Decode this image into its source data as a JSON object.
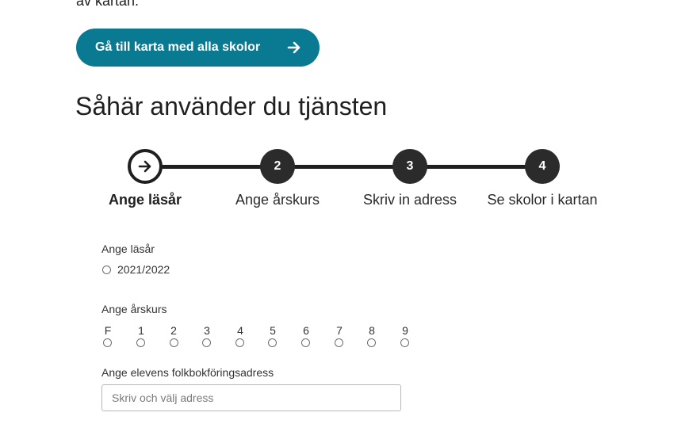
{
  "intro_fragment": "av kartan.",
  "cta": {
    "label": "Gå till karta med alla skolor"
  },
  "section_title": "Såhär använder du tjänsten",
  "steps": [
    {
      "number": "",
      "label": "Ange läsår",
      "icon": "arrow-right-icon",
      "active": true
    },
    {
      "number": "2",
      "label": "Ange årskurs",
      "active": false
    },
    {
      "number": "3",
      "label": "Skriv in adress",
      "active": false
    },
    {
      "number": "4",
      "label": "Se skolor i kartan",
      "active": false
    }
  ],
  "form": {
    "school_year": {
      "label": "Ange läsår",
      "options": [
        "2021/2022"
      ]
    },
    "grade": {
      "label": "Ange årskurs",
      "options": [
        "F",
        "1",
        "2",
        "3",
        "4",
        "5",
        "6",
        "7",
        "8",
        "9"
      ]
    },
    "address": {
      "label": "Ange elevens folkbokföringsadress",
      "placeholder": "Skriv och välj adress"
    }
  },
  "colors": {
    "accent": "#0a7a92",
    "step_dark": "#2b2b2b"
  }
}
